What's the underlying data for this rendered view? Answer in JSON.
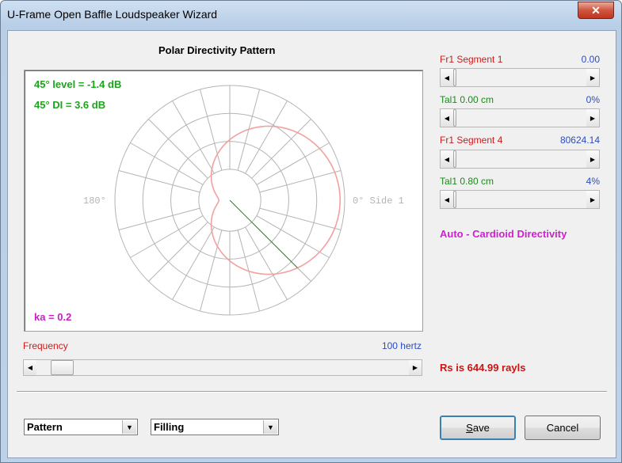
{
  "window": {
    "title": "U-Frame Open Baffle Loudspeaker Wizard",
    "close_glyph": "✕"
  },
  "plot": {
    "title": "Polar Directivity Pattern",
    "level_text": "45° level = -1.4 dB",
    "di_text": "45° DI = 3.6 dB",
    "ka_text": "ka = 0.2",
    "label_180": "180°",
    "label_0": "0° Side 1",
    "pattern_color": "#f2a0a0",
    "indicator_color": "#1a8a1a",
    "grid_color": "#b4b4b4",
    "indicator_angle_deg": 45
  },
  "frequency": {
    "label": "Frequency",
    "value": "100 hertz",
    "position": 0.04
  },
  "sliders": [
    {
      "label": "Fr1  Segment 1",
      "value": "0.00",
      "label_color": "#cc1b1b",
      "position": 0.0
    },
    {
      "label": "Tal1  0.00 cm",
      "value": "0%",
      "label_color": "#1a8a1a",
      "position": 0.0
    },
    {
      "label": "Fr1  Segment 4",
      "value": "80624.14",
      "label_color": "#cc1b1b",
      "position": 0.0
    },
    {
      "label": "Tal1  0.80 cm",
      "value": "4%",
      "label_color": "#1a8a1a",
      "position": 0.0
    }
  ],
  "status": {
    "auto_text": "Auto - Cardioid Directivity",
    "rs_text": "Rs is 644.99 rayls"
  },
  "controls": {
    "combo1_value": "Pattern",
    "combo2_value": "Filling",
    "save_first": "S",
    "save_rest": "ave",
    "cancel_label": "Cancel"
  },
  "icons": {
    "close": "close-icon",
    "scroll_left": "left-arrow-icon",
    "scroll_right": "right-arrow-icon",
    "dropdown": "chevron-down-icon"
  }
}
